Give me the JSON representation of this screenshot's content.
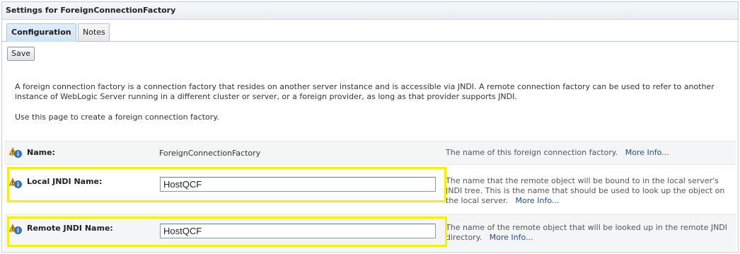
{
  "header": {
    "title": "Settings for ForeignConnectionFactory"
  },
  "tabs": [
    {
      "label": "Configuration",
      "active": true
    },
    {
      "label": "Notes",
      "active": false
    }
  ],
  "toolbar": {
    "save_label": "Save"
  },
  "description": {
    "paragraph_1": "A foreign connection factory is a connection factory that resides on another server instance and is accessible via JNDI. A remote connection factory can be used to refer to another instance of WebLogic Server running in a different cluster or server, or a foreign provider, as long as that provider supports JNDI.",
    "paragraph_2": "Use this page to create a foreign connection factory."
  },
  "fields": {
    "name": {
      "label": "Name:",
      "value": "ForeignConnectionFactory",
      "help": "The name of this foreign connection factory.",
      "more_info": "More Info...",
      "icon": "info-warning-icon"
    },
    "local_jndi": {
      "label": "Local JNDI Name:",
      "value": "HostQCF",
      "help": "The name that the remote object will be bound to in the local server's JNDI tree. This is the name that should be used to look up the object on the local server.",
      "more_info": "More Info...",
      "icon": "info-warning-icon"
    },
    "remote_jndi": {
      "label": "Remote JNDI Name:",
      "value": "HostQCF",
      "help": "The name of the remote object that will be looked up in the remote JNDI directory.",
      "more_info": "More Info...",
      "icon": "info-warning-icon"
    }
  },
  "colors": {
    "highlight": "#f2f20a",
    "link": "#1e4f86",
    "active_tab": "#cfe4f4"
  }
}
